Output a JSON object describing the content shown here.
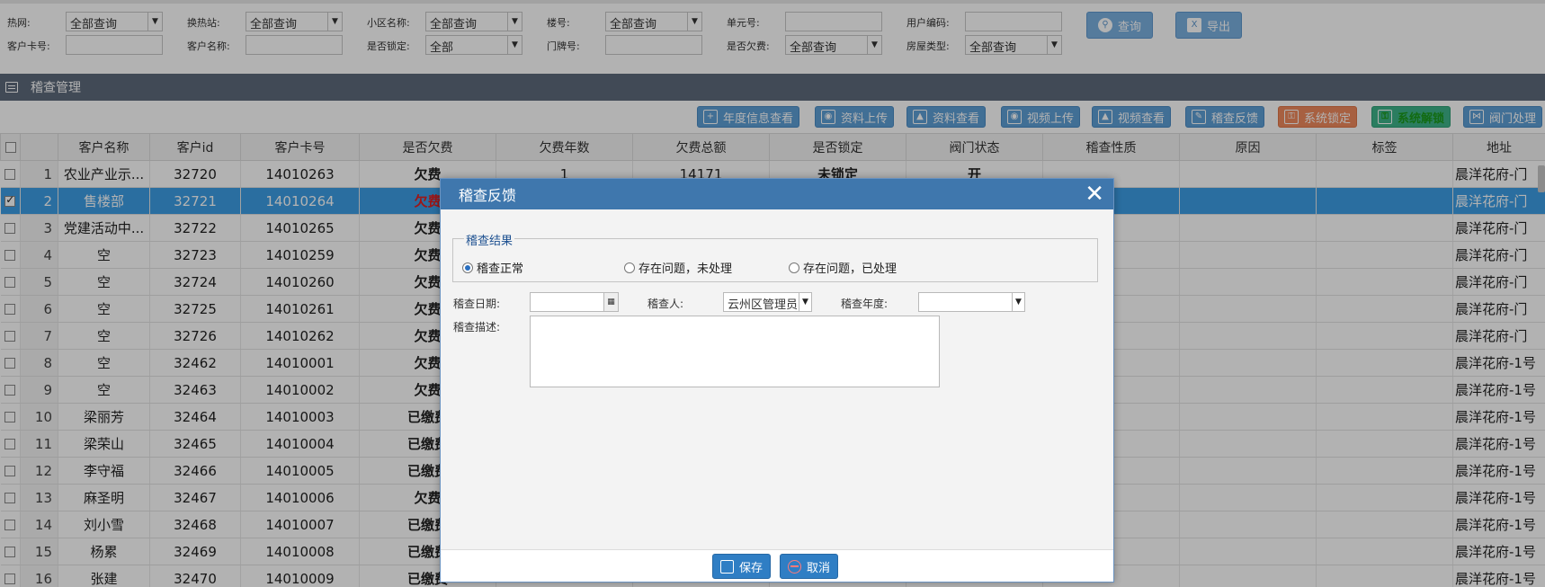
{
  "filters": {
    "row1": [
      {
        "label": "热网:",
        "value": "全部查询",
        "dropdown": true
      },
      {
        "label": "换热站:",
        "value": "全部查询",
        "dropdown": true
      },
      {
        "label": "小区名称:",
        "value": "全部查询",
        "dropdown": true
      },
      {
        "label": "楼号:",
        "value": "全部查询",
        "dropdown": true
      },
      {
        "label": "单元号:",
        "value": "",
        "dropdown": false
      },
      {
        "label": "用户编码:",
        "value": "",
        "dropdown": false
      }
    ],
    "row2": [
      {
        "label": "客户卡号:",
        "value": "",
        "dropdown": false
      },
      {
        "label": "客户名称:",
        "value": "",
        "dropdown": false
      },
      {
        "label": "是否锁定:",
        "value": "全部",
        "dropdown": true
      },
      {
        "label": "门牌号:",
        "value": "",
        "dropdown": false
      },
      {
        "label": "是否欠费:",
        "value": "全部查询",
        "dropdown": true
      },
      {
        "label": "房屋类型:",
        "value": "全部查询",
        "dropdown": true
      }
    ],
    "query_label": "查询",
    "export_label": "导出"
  },
  "panel": {
    "title": "稽查管理"
  },
  "toolbar": [
    {
      "label": "年度信息查看",
      "icon": "plus-square-icon",
      "color": "blue"
    },
    {
      "label": "资料上传",
      "icon": "camera-icon",
      "color": "blue"
    },
    {
      "label": "资料查看",
      "icon": "image-icon",
      "color": "blue"
    },
    {
      "label": "视频上传",
      "icon": "camera-icon",
      "color": "blue"
    },
    {
      "label": "视频查看",
      "icon": "image-icon",
      "color": "blue"
    },
    {
      "label": "稽查反馈",
      "icon": "edit-icon",
      "color": "blue"
    },
    {
      "label": "系统锁定",
      "icon": "lock-icon",
      "color": "orange"
    },
    {
      "label": "系统解锁",
      "icon": "unlock-icon",
      "color": "green"
    },
    {
      "label": "阀门处理",
      "icon": "valve-icon",
      "color": "blue"
    }
  ],
  "grid": {
    "columns": [
      "客户名称",
      "客户id",
      "客户卡号",
      "是否欠费",
      "欠费年数",
      "欠费总额",
      "是否锁定",
      "阀门状态",
      "稽查性质",
      "原因",
      "标签",
      "地址"
    ],
    "rows": [
      {
        "n": "1",
        "name": "农业产业示...",
        "id": "32720",
        "card": "14010263",
        "arrears": "欠费",
        "status": "red",
        "years": "1",
        "total": "14171",
        "locked": "未锁定",
        "valve": "开",
        "addr": "晨洋花府-门",
        "checked": false
      },
      {
        "n": "2",
        "name": "售楼部",
        "id": "32721",
        "card": "14010264",
        "arrears": "欠费",
        "status": "red",
        "years": "",
        "total": "",
        "locked": "",
        "valve": "",
        "addr": "晨洋花府-门",
        "checked": true
      },
      {
        "n": "3",
        "name": "党建活动中...",
        "id": "32722",
        "card": "14010265",
        "arrears": "欠费",
        "status": "red",
        "years": "",
        "total": "",
        "locked": "",
        "valve": "",
        "addr": "晨洋花府-门",
        "checked": false
      },
      {
        "n": "4",
        "name": "空",
        "id": "32723",
        "card": "14010259",
        "arrears": "欠费",
        "status": "red",
        "years": "",
        "total": "",
        "locked": "",
        "valve": "",
        "addr": "晨洋花府-门",
        "checked": false
      },
      {
        "n": "5",
        "name": "空",
        "id": "32724",
        "card": "14010260",
        "arrears": "欠费",
        "status": "red",
        "years": "",
        "total": "",
        "locked": "",
        "valve": "",
        "addr": "晨洋花府-门",
        "checked": false
      },
      {
        "n": "6",
        "name": "空",
        "id": "32725",
        "card": "14010261",
        "arrears": "欠费",
        "status": "red",
        "years": "",
        "total": "",
        "locked": "",
        "valve": "",
        "addr": "晨洋花府-门",
        "checked": false
      },
      {
        "n": "7",
        "name": "空",
        "id": "32726",
        "card": "14010262",
        "arrears": "欠费",
        "status": "red",
        "years": "",
        "total": "",
        "locked": "",
        "valve": "",
        "addr": "晨洋花府-门",
        "checked": false
      },
      {
        "n": "8",
        "name": "空",
        "id": "32462",
        "card": "14010001",
        "arrears": "欠费",
        "status": "red",
        "years": "",
        "total": "",
        "locked": "",
        "valve": "",
        "addr": "晨洋花府-1号",
        "checked": false
      },
      {
        "n": "9",
        "name": "空",
        "id": "32463",
        "card": "14010002",
        "arrears": "欠费",
        "status": "red",
        "years": "",
        "total": "",
        "locked": "",
        "valve": "",
        "addr": "晨洋花府-1号",
        "checked": false
      },
      {
        "n": "10",
        "name": "梁丽芳",
        "id": "32464",
        "card": "14010003",
        "arrears": "已缴费",
        "status": "green",
        "years": "",
        "total": "",
        "locked": "",
        "valve": "",
        "addr": "晨洋花府-1号",
        "checked": false
      },
      {
        "n": "11",
        "name": "梁荣山",
        "id": "32465",
        "card": "14010004",
        "arrears": "已缴费",
        "status": "green",
        "years": "",
        "total": "",
        "locked": "",
        "valve": "",
        "addr": "晨洋花府-1号",
        "checked": false
      },
      {
        "n": "12",
        "name": "李守福",
        "id": "32466",
        "card": "14010005",
        "arrears": "已缴费",
        "status": "green",
        "years": "",
        "total": "",
        "locked": "",
        "valve": "",
        "addr": "晨洋花府-1号",
        "checked": false
      },
      {
        "n": "13",
        "name": "麻圣明",
        "id": "32467",
        "card": "14010006",
        "arrears": "欠费",
        "status": "red",
        "years": "",
        "total": "",
        "locked": "",
        "valve": "",
        "addr": "晨洋花府-1号",
        "checked": false
      },
      {
        "n": "14",
        "name": "刘小雪",
        "id": "32468",
        "card": "14010007",
        "arrears": "已缴费",
        "status": "green",
        "years": "",
        "total": "",
        "locked": "",
        "valve": "",
        "addr": "晨洋花府-1号",
        "checked": false
      },
      {
        "n": "15",
        "name": "杨累",
        "id": "32469",
        "card": "14010008",
        "arrears": "已缴费",
        "status": "green",
        "years": "",
        "total": "",
        "locked": "",
        "valve": "",
        "addr": "晨洋花府-1号",
        "checked": false
      },
      {
        "n": "16",
        "name": "张建",
        "id": "32470",
        "card": "14010009",
        "arrears": "已缴费",
        "status": "green",
        "years": "",
        "total": "",
        "locked": "",
        "valve": "",
        "addr": "晨洋花府-1号",
        "checked": false
      }
    ],
    "selected_row": 2
  },
  "dialog": {
    "title": "稽查反馈",
    "close_glyph": "✕",
    "result_legend": "稽查结果",
    "radios": [
      {
        "label": "稽查正常",
        "checked": true
      },
      {
        "label": "存在问题，未处理",
        "checked": false
      },
      {
        "label": "存在问题，已处理",
        "checked": false
      }
    ],
    "date_label": "稽查日期:",
    "date_value": "",
    "inspector_label": "稽查人:",
    "inspector_value": "云州区管理员",
    "year_label": "稽查年度:",
    "year_value": "",
    "desc_label": "稽查描述:",
    "desc_value": "",
    "save_label": "保存",
    "cancel_label": "取消"
  },
  "colors": {
    "header_bar": "#5d6a7c",
    "dialog_header": "#3f77ad",
    "selected_row": "#3d9ee6",
    "arrears_red": "#e02020",
    "paid_green": "#1a9a1a",
    "lock_orange": "#f08a5d",
    "unlock_green": "#3eb48a"
  }
}
